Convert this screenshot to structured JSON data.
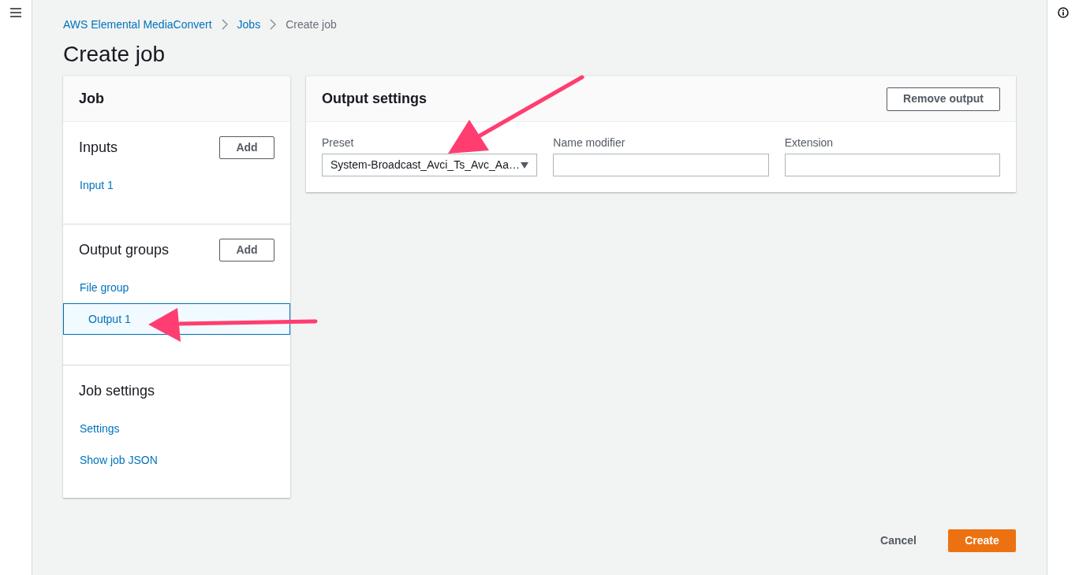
{
  "breadcrumbs": [
    {
      "label": "AWS Elemental MediaConvert",
      "current": false
    },
    {
      "label": "Jobs",
      "current": false
    },
    {
      "label": "Create job",
      "current": true
    }
  ],
  "page_title": "Create job",
  "job_panel": {
    "title": "Job",
    "sections": [
      {
        "title": "Inputs",
        "add_button": "Add",
        "items": [
          {
            "label": "Input 1",
            "selected": false
          }
        ]
      },
      {
        "title": "Output groups",
        "add_button": "Add",
        "items": [
          {
            "label": "File group",
            "selected": false,
            "children": [
              {
                "label": "Output 1",
                "selected": true
              }
            ]
          }
        ]
      },
      {
        "title": "Job settings",
        "items": [
          {
            "label": "Settings",
            "selected": false
          },
          {
            "label": "Show job JSON",
            "selected": false
          }
        ]
      }
    ]
  },
  "output_settings": {
    "title": "Output settings",
    "remove_button": "Remove output",
    "fields": [
      {
        "label": "Preset",
        "kind": "select",
        "value": "System-Broadcast_Avci_Ts_Avc_Aa…"
      },
      {
        "label": "Name modifier",
        "kind": "text"
      },
      {
        "label": "Extension",
        "kind": "text"
      }
    ]
  },
  "footer_buttons": [
    {
      "label": "Cancel",
      "kind": "link"
    },
    {
      "label": "Create",
      "kind": "primary"
    }
  ]
}
